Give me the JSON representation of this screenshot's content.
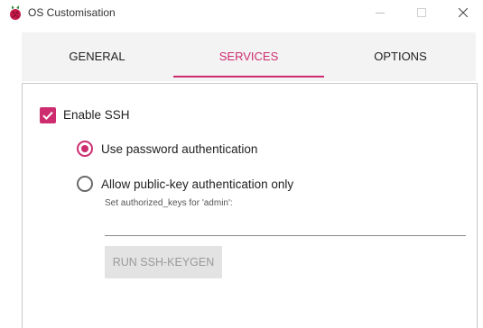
{
  "window": {
    "title": "OS Customisation",
    "icon": "raspberry-pi-icon"
  },
  "tabs": [
    {
      "label": "GENERAL",
      "active": false
    },
    {
      "label": "SERVICES",
      "active": true
    },
    {
      "label": "OPTIONS",
      "active": false
    }
  ],
  "services": {
    "enable_ssh_label": "Enable SSH",
    "enable_ssh_checked": true,
    "password_auth_label": "Use password authentication",
    "password_auth_selected": true,
    "pubkey_auth_label": "Allow public-key authentication only",
    "pubkey_auth_selected": false,
    "authorized_keys_hint": "Set authorized_keys for 'admin':",
    "authorized_keys_value": "",
    "keygen_button_label": "RUN SSH-KEYGEN",
    "keygen_button_enabled": false
  },
  "colors": {
    "accent": "#cd2d6f",
    "tab_bg": "#f3f3f3",
    "disabled_button_bg": "#e3e3e3",
    "disabled_button_text": "#9a9a9a"
  }
}
